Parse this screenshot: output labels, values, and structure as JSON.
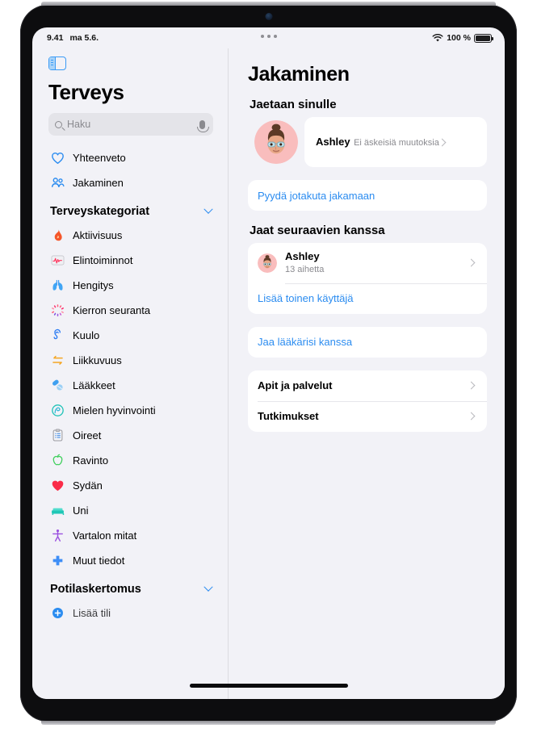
{
  "statusbar": {
    "time": "9.41",
    "date": "ma 5.6.",
    "wifi_icon": "wifi-icon",
    "battery_percent": "100 %",
    "multitask_icon": "multitasking-dots-icon"
  },
  "sidebar": {
    "toggle_icon": "sidebar-toggle-icon",
    "app_title": "Terveys",
    "search": {
      "placeholder": "Haku",
      "search_icon": "search-icon",
      "mic_icon": "microphone-icon"
    },
    "top_items": [
      {
        "label": "Yhteenveto",
        "icon": "heart-outline-icon"
      },
      {
        "label": "Jakaminen",
        "icon": "two-people-icon"
      }
    ],
    "categories_group": {
      "label": "Terveyskategoriat",
      "chevron_icon": "chevron-down-icon",
      "items": [
        {
          "label": "Aktiivisuus",
          "icon": "flame-icon",
          "color": "#F5562A"
        },
        {
          "label": "Elintoiminnot",
          "icon": "waveform-icon",
          "color": "#FF375F"
        },
        {
          "label": "Hengitys",
          "icon": "lungs-icon",
          "color": "#41A5F5"
        },
        {
          "label": "Kierron seuranta",
          "icon": "cycle-tracking-icon",
          "color": "#FF5C7A"
        },
        {
          "label": "Kuulo",
          "icon": "ear-icon",
          "color": "#2B7BF3"
        },
        {
          "label": "Liikkuvuus",
          "icon": "mobility-arrows-icon",
          "color": "#F5A623"
        },
        {
          "label": "Lääkkeet",
          "icon": "pills-icon",
          "color": "#3FA0F0"
        },
        {
          "label": "Mielen hyvinvointi",
          "icon": "mindfulness-head-icon",
          "color": "#23C3B8"
        },
        {
          "label": "Oireet",
          "icon": "clipboard-icon",
          "color": "#8E8E93"
        },
        {
          "label": "Ravinto",
          "icon": "apple-icon",
          "color": "#3ECF5B"
        },
        {
          "label": "Sydän",
          "icon": "heart-filled-icon",
          "color": "#FA2B48"
        },
        {
          "label": "Uni",
          "icon": "bed-icon",
          "color": "#1FC7B6"
        },
        {
          "label": "Vartalon mitat",
          "icon": "body-measure-icon",
          "color": "#9B51E0"
        },
        {
          "label": "Muut tiedot",
          "icon": "plus-cross-icon",
          "color": "#3E8EF7"
        }
      ]
    },
    "records_group": {
      "label": "Potilaskertomus",
      "chevron_icon": "chevron-down-icon",
      "add_account": {
        "label": "Lisää tili",
        "icon": "plus-circle-icon"
      }
    }
  },
  "main": {
    "page_title": "Jakaminen",
    "shared_with_you": {
      "title": "Jaetaan sinulle",
      "person": {
        "name": "Ashley",
        "subtitle": "Ei äskeisiä muutoksia",
        "avatar": "memoji-avatar",
        "chevron_icon": "chevron-right-icon"
      },
      "request_link": "Pyydä jotakuta jakamaan"
    },
    "sharing_with": {
      "title": "Jaat seuraavien kanssa",
      "person": {
        "name": "Ashley",
        "subtitle": "13 aihetta",
        "avatar": "memoji-avatar",
        "chevron_icon": "chevron-right-icon"
      },
      "add_person_link": "Lisää toinen käyttäjä",
      "share_doctor_link": "Jaa lääkärisi kanssa",
      "list_rows": [
        {
          "label": "Apit ja palvelut",
          "chevron_icon": "chevron-right-icon"
        },
        {
          "label": "Tutkimukset",
          "chevron_icon": "chevron-right-icon"
        }
      ]
    }
  },
  "colors": {
    "accent": "#2b8cf0",
    "screen_bg": "#f2f2f7",
    "card_bg": "#ffffff"
  }
}
